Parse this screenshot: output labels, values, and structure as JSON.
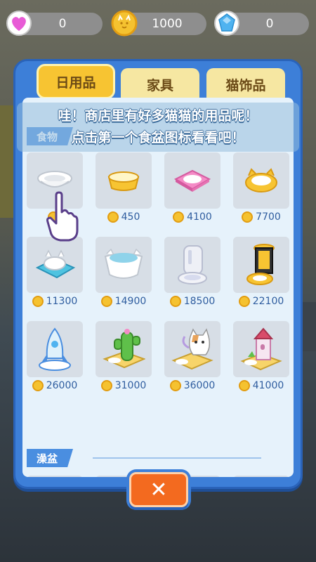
{
  "currencies": {
    "heart": {
      "value": "0",
      "icon": "heart-icon",
      "color": "#e85bd6"
    },
    "coin": {
      "value": "1000",
      "icon": "cat-coin-icon",
      "color": "#f5c230"
    },
    "gem": {
      "value": "0",
      "icon": "gem-icon",
      "color": "#4fb3f0"
    }
  },
  "tabs": [
    {
      "label": "日用品",
      "active": true
    },
    {
      "label": "家具",
      "active": false
    },
    {
      "label": "猫饰品",
      "active": false
    }
  ],
  "tutorial": {
    "line1": "哇！商店里有好多猫猫的用品呢！",
    "line2": "点击第一个食盆图标看看吧！"
  },
  "sections": {
    "food": {
      "label": "食物"
    },
    "bath": {
      "label": "澡盆"
    }
  },
  "items": [
    {
      "name": "white-bowl",
      "price": ""
    },
    {
      "name": "yellow-bowl",
      "price": "450"
    },
    {
      "name": "pink-bowl",
      "price": "4100"
    },
    {
      "name": "cat-ear-bowl",
      "price": "7700"
    },
    {
      "name": "cat-face-bowl",
      "price": "11300"
    },
    {
      "name": "cat-cup-bowl",
      "price": "14900"
    },
    {
      "name": "auto-feeder",
      "price": "18500"
    },
    {
      "name": "tower-feeder",
      "price": "22100"
    },
    {
      "name": "rocket-feeder",
      "price": "26000"
    },
    {
      "name": "cactus-feeder",
      "price": "31000"
    },
    {
      "name": "cat-statue-feeder",
      "price": "36000"
    },
    {
      "name": "castle-feeder",
      "price": "41000"
    }
  ],
  "close_label": "✕",
  "accent_colors": {
    "panel": "#3d7fd8",
    "tab_active": "#f7c432",
    "close": "#f36a1f"
  }
}
